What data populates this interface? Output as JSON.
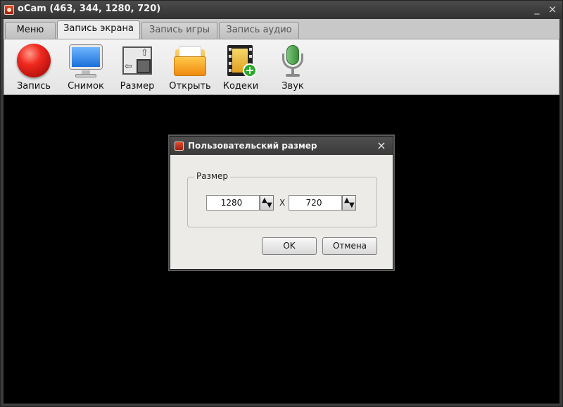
{
  "window": {
    "title": "oCam (463, 344, 1280, 720)",
    "minimize_glyph": "_",
    "close_glyph": "×"
  },
  "tabs": [
    {
      "label": "Меню",
      "active": false
    },
    {
      "label": "Запись экрана",
      "active": true
    },
    {
      "label": "Запись игры",
      "active": false
    },
    {
      "label": "Запись аудио",
      "active": false
    }
  ],
  "toolbar": {
    "items": [
      {
        "label": "Запись",
        "icon": "record-icon"
      },
      {
        "label": "Снимок",
        "icon": "monitor-icon"
      },
      {
        "label": "Размер",
        "icon": "resize-icon"
      },
      {
        "label": "Открыть",
        "icon": "folder-icon"
      },
      {
        "label": "Кодеки",
        "icon": "codec-film-icon"
      },
      {
        "label": "Звук",
        "icon": "microphone-icon"
      }
    ]
  },
  "dialog": {
    "title": "Пользовательский размер",
    "close_glyph": "×",
    "group_label": "Размер",
    "width_value": "1280",
    "height_value": "720",
    "separator": "X",
    "ok_label": "OK",
    "cancel_label": "Отмена"
  },
  "colors": {
    "capture_background": "#000000",
    "record_red": "#f02a20",
    "monitor_blue": "#1a6fd8",
    "folder_orange": "#f08a10",
    "codec_green": "#2aa82a"
  }
}
